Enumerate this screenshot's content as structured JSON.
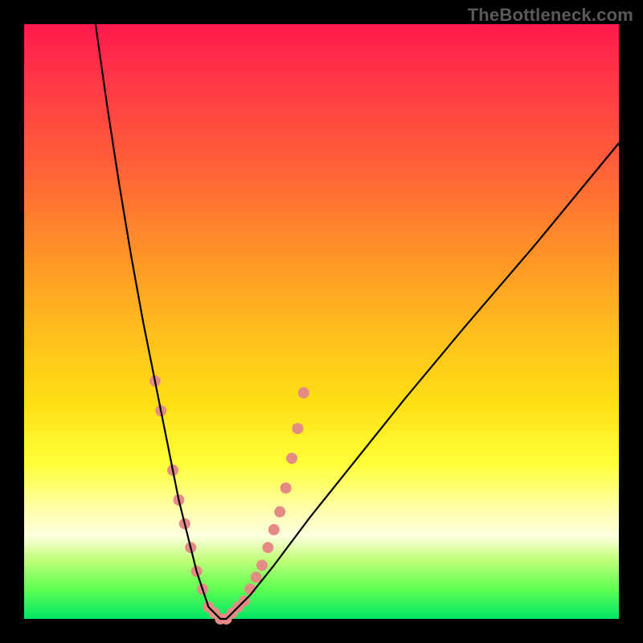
{
  "watermark": "TheBottleneck.com",
  "chart_data": {
    "type": "line",
    "title": "",
    "xlabel": "",
    "ylabel": "",
    "xlim": [
      0,
      100
    ],
    "ylim": [
      0,
      100
    ],
    "grid": false,
    "legend": false,
    "series": [
      {
        "name": "bottleneck-curve",
        "color": "#000000",
        "x": [
          12,
          14,
          16,
          18,
          20,
          22,
          23,
          24,
          25,
          26,
          27,
          28,
          29,
          30,
          31,
          32,
          33,
          34,
          35,
          36,
          38,
          42,
          48,
          56,
          64,
          74,
          86,
          100
        ],
        "values": [
          100,
          86,
          73,
          61,
          50,
          40,
          35,
          30,
          25,
          20,
          16,
          12,
          8,
          5,
          2,
          1,
          0,
          0,
          1,
          2,
          4,
          9,
          17,
          27,
          37,
          49,
          63,
          80
        ]
      }
    ],
    "markers": {
      "name": "highlight-dots",
      "color": "#e58b86",
      "radius_px": 7,
      "points": [
        {
          "x": 22,
          "y": 40
        },
        {
          "x": 23,
          "y": 35
        },
        {
          "x": 25,
          "y": 25
        },
        {
          "x": 26,
          "y": 20
        },
        {
          "x": 27,
          "y": 16
        },
        {
          "x": 28,
          "y": 12
        },
        {
          "x": 29,
          "y": 8
        },
        {
          "x": 30,
          "y": 5
        },
        {
          "x": 31,
          "y": 2
        },
        {
          "x": 32,
          "y": 1
        },
        {
          "x": 33,
          "y": 0
        },
        {
          "x": 34,
          "y": 0
        },
        {
          "x": 35,
          "y": 1
        },
        {
          "x": 36,
          "y": 2
        },
        {
          "x": 37,
          "y": 3
        },
        {
          "x": 38,
          "y": 5
        },
        {
          "x": 39,
          "y": 7
        },
        {
          "x": 40,
          "y": 9
        },
        {
          "x": 41,
          "y": 12
        },
        {
          "x": 42,
          "y": 15
        },
        {
          "x": 43,
          "y": 18
        },
        {
          "x": 44,
          "y": 22
        },
        {
          "x": 45,
          "y": 27
        },
        {
          "x": 46,
          "y": 32
        },
        {
          "x": 47,
          "y": 38
        }
      ]
    }
  }
}
